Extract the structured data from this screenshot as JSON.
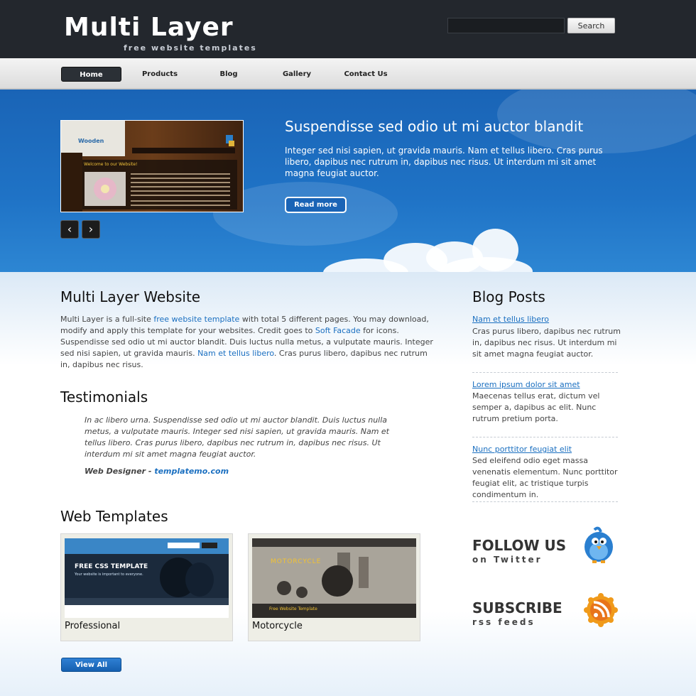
{
  "header": {
    "title": "Multi Layer",
    "tagline": "free website templates",
    "search_placeholder": "",
    "search_button": "Search"
  },
  "nav": {
    "items": [
      {
        "label": "Home",
        "active": true
      },
      {
        "label": "Products"
      },
      {
        "label": "Blog"
      },
      {
        "label": "Gallery"
      },
      {
        "label": "Contact Us"
      }
    ]
  },
  "hero": {
    "title": "Suspendisse sed odio ut mi auctor blandit",
    "text": "Integer sed nisi sapien, ut gravida mauris. Nam et tellus libero. Cras purus libero, dapibus nec rutrum in, dapibus nec risus. Ut interdum mi sit amet magna feugiat auctor.",
    "button": "Read more",
    "prev_arrow": "‹",
    "next_arrow": "›",
    "thumb": {
      "brand": "Wooden",
      "welcome": "Welcome to our Website!"
    }
  },
  "main": {
    "intro_title": "Multi Layer Website",
    "intro_p1": "Multi Layer is a full-site ",
    "intro_link1": "free website template",
    "intro_p2": " with total 5 different pages. You may download, modify and apply this template for your websites. Credit goes to ",
    "intro_link2": "Soft Facade",
    "intro_p3": " for icons. Suspendisse sed odio ut mi auctor blandit. Duis luctus nulla metus, a vulputate mauris. Integer sed nisi sapien, ut gravida mauris. ",
    "intro_link3": "Nam et tellus libero",
    "intro_p4": ". Cras purus libero, dapibus nec rutrum in, dapibus nec risus.",
    "testimonials_title": "Testimonials",
    "testimonial_text": "In ac libero urna. Suspendisse sed odio ut mi auctor blandit. Duis luctus nulla metus, a vulputate mauris. Integer sed nisi sapien, ut gravida mauris. Nam et tellus libero. Cras purus libero, dapibus nec rutrum in, dapibus nec risus. Ut interdum mi sit amet magna feugiat auctor.",
    "testimonial_author": "Web Designer - ",
    "testimonial_link": "templatemo.com",
    "templates_title": "Web Templates",
    "templates": [
      {
        "label": "Professional",
        "shot_title": "FREE CSS TEMPLATE",
        "shot_sub": "Your website is important to everyone."
      },
      {
        "label": "Motorcycle",
        "shot_title": "MOTORCYCLE",
        "shot_sub": "Free Website Template"
      }
    ],
    "view_all": "View All"
  },
  "sidebar": {
    "blog_title": "Blog Posts",
    "posts": [
      {
        "title": "Nam et tellus libero",
        "text": "Cras purus libero, dapibus nec rutrum in, dapibus nec risus. Ut interdum mi sit amet magna feugiat auctor."
      },
      {
        "title": "Lorem ipsum dolor sit amet",
        "text": "Maecenas tellus erat, dictum vel semper a, dapibus ac elit. Nunc rutrum pretium porta."
      },
      {
        "title": "Nunc porttitor feugiat elit",
        "text": "Sed eleifend odio eget massa venenatis elementum. Nunc porttitor feugiat elit, ac tristique turpis condimentum in."
      }
    ],
    "follow_big": "FOLLOW US",
    "follow_small": "on Twitter",
    "subscribe_big": "SUBSCRIBE",
    "subscribe_small": "rss feeds"
  }
}
